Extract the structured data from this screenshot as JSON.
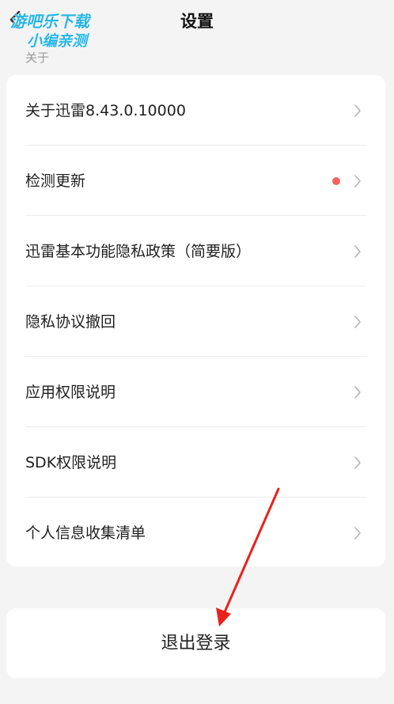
{
  "header": {
    "title": "设置",
    "back_icon": "chevron-left-icon",
    "watermark": "游吧乐下载 小编亲测"
  },
  "section": {
    "label": "关于"
  },
  "menu": {
    "items": [
      {
        "label": "关于迅雷8.43.0.10000",
        "icon": "chevron-right-icon",
        "badge": false
      },
      {
        "label": "检测更新",
        "icon": "chevron-right-icon",
        "badge": true
      },
      {
        "label": "迅雷基本功能隐私政策（简要版）",
        "icon": "chevron-right-icon",
        "badge": false
      },
      {
        "label": "隐私协议撤回",
        "icon": "chevron-right-icon",
        "badge": false
      },
      {
        "label": "应用权限说明",
        "icon": "chevron-right-icon",
        "badge": false
      },
      {
        "label": "SDK权限说明",
        "icon": "chevron-right-icon",
        "badge": false
      },
      {
        "label": "个人信息收集清单",
        "icon": "chevron-right-icon",
        "badge": false
      }
    ]
  },
  "logout": {
    "label": "退出登录"
  },
  "colors": {
    "background": "#f4f4f4",
    "card": "#ffffff",
    "badge": "#f2645f",
    "annotation_arrow": "#e8221c",
    "watermark": "#27b6e6"
  }
}
